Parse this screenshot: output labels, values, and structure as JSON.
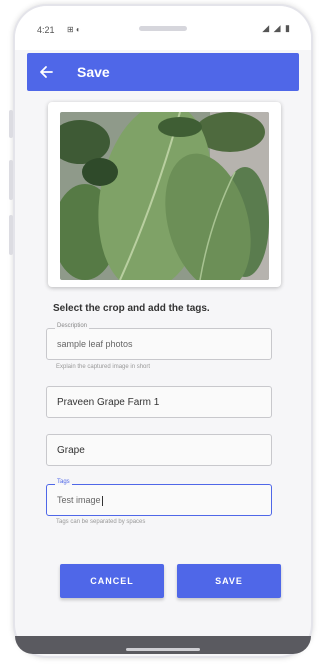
{
  "status_bar": {
    "time": "4:21",
    "left_icons": "⊞ ◐",
    "right_icons": "◢ ◢ ▮"
  },
  "app_bar": {
    "title": "Save",
    "color": "#4f67e8"
  },
  "instruction": "Select the crop and add the tags.",
  "fields": {
    "description": {
      "label": "Description",
      "value": "sample leaf photos",
      "helper": "Explain the captured image in short"
    },
    "farm": {
      "value": "Praveen Grape Farm 1"
    },
    "crop": {
      "value": "Grape"
    },
    "tags": {
      "label": "Tags",
      "value": "Test image",
      "helper": "Tags can be separated by spaces"
    }
  },
  "buttons": {
    "cancel": "CANCEL",
    "save": "SAVE"
  }
}
